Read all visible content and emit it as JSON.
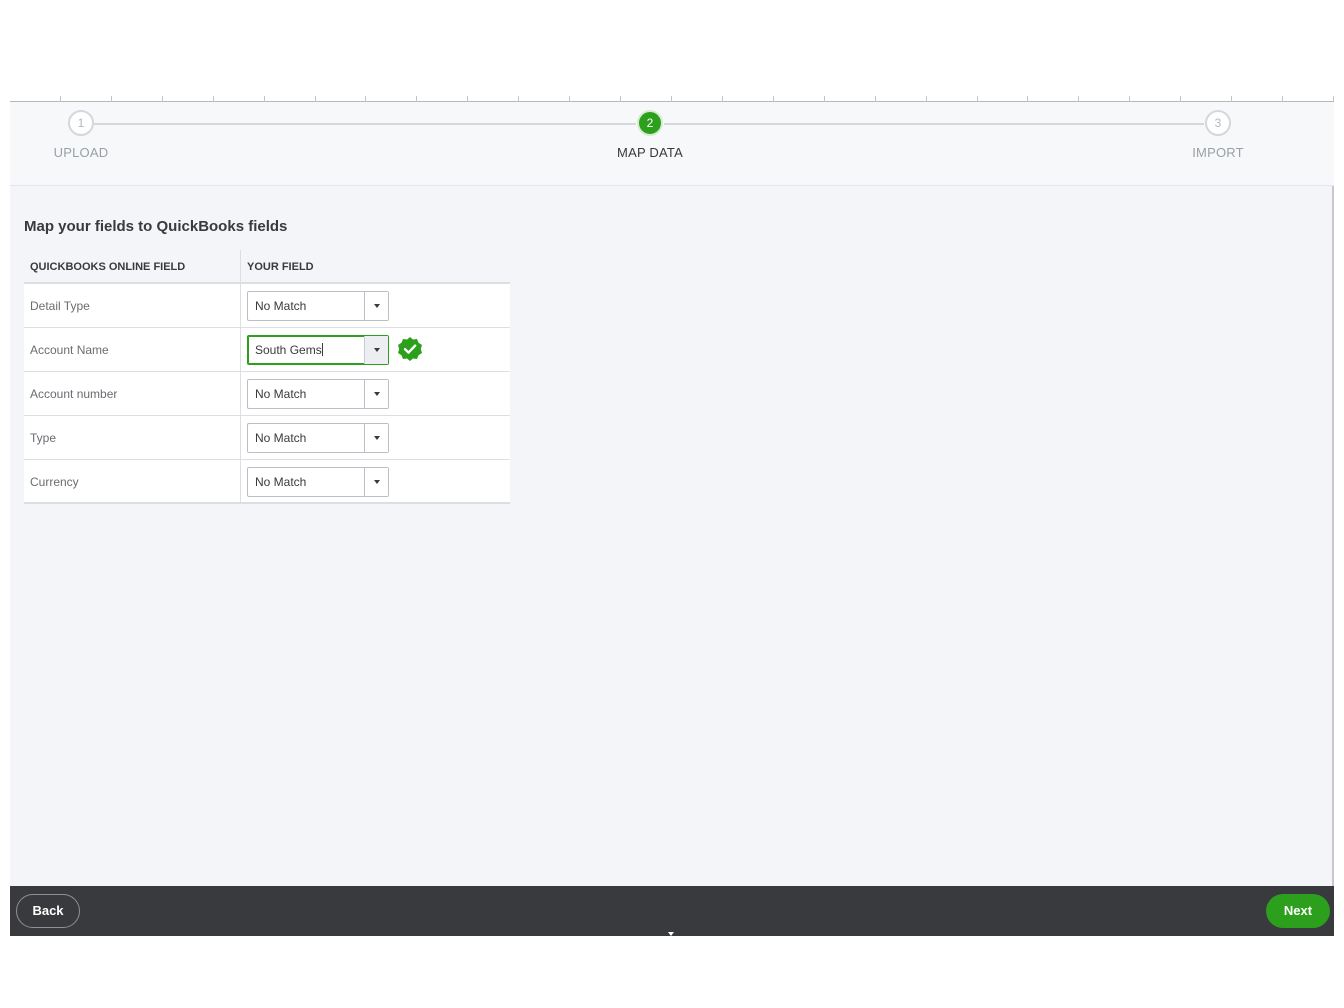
{
  "stepper": {
    "steps": [
      {
        "number": "1",
        "label": "UPLOAD",
        "active": false
      },
      {
        "number": "2",
        "label": "MAP DATA",
        "active": true
      },
      {
        "number": "3",
        "label": "IMPORT",
        "active": false
      }
    ]
  },
  "main": {
    "title": "Map your fields to QuickBooks fields",
    "table": {
      "headers": [
        "QUICKBOOKS ONLINE FIELD",
        "YOUR FIELD"
      ],
      "rows": [
        {
          "field": "Detail Type",
          "value": "No Match",
          "matched": false
        },
        {
          "field": "Account Name",
          "value": "South Gems",
          "matched": true
        },
        {
          "field": "Account number",
          "value": "No Match",
          "matched": false
        },
        {
          "field": "Type",
          "value": "No Match",
          "matched": false
        },
        {
          "field": "Currency",
          "value": "No Match",
          "matched": false
        }
      ]
    }
  },
  "footer": {
    "back_label": "Back",
    "next_label": "Next"
  },
  "colors": {
    "accent_green": "#2ca01c",
    "footer_bg": "#393a3d",
    "page_bg": "#f4f5f8"
  },
  "icons": {
    "matched": "check-circle-icon",
    "dropdown": "caret-down-icon"
  }
}
